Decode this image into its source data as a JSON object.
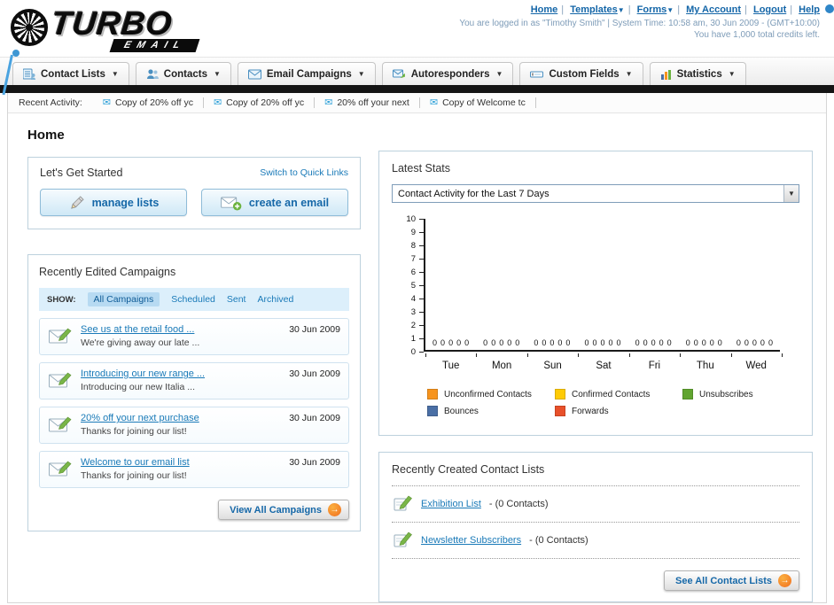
{
  "header": {
    "logo_title": "TURBO",
    "logo_subtitle": "EMAIL",
    "nav": [
      {
        "label": "Home"
      },
      {
        "label": "Templates"
      },
      {
        "label": "Forms"
      },
      {
        "label": "My Account"
      },
      {
        "label": "Logout"
      },
      {
        "label": "Help"
      }
    ],
    "login_info": "You are logged in as \"Timothy Smith\" | System Time: 10:58 am, 30 Jun 2009 - (GMT+10:00)",
    "credits_info": "You have 1,000 total credits left."
  },
  "tabs": [
    {
      "label": "Contact Lists"
    },
    {
      "label": "Contacts"
    },
    {
      "label": "Email Campaigns"
    },
    {
      "label": "Autoresponders"
    },
    {
      "label": "Custom Fields"
    },
    {
      "label": "Statistics"
    }
  ],
  "activity": {
    "label": "Recent Activity:",
    "items": [
      {
        "text": "Copy of 20% off yc"
      },
      {
        "text": "Copy of 20% off yc"
      },
      {
        "text": "20% off your next"
      },
      {
        "text": "Copy of Welcome tc"
      }
    ]
  },
  "page_title": "Home",
  "get_started": {
    "title": "Let's Get Started",
    "switch_link": "Switch to Quick Links",
    "manage_button": "manage lists",
    "create_button": "create an email"
  },
  "campaigns": {
    "title": "Recently Edited Campaigns",
    "show_label": "SHOW:",
    "filters": [
      "All Campaigns",
      "Scheduled",
      "Sent",
      "Archived"
    ],
    "items": [
      {
        "title": "See us at the retail food ...",
        "subtitle": "We're giving away our late ...",
        "date": "30 Jun 2009"
      },
      {
        "title": "Introducing our new range ...",
        "subtitle": "Introducing our new Italia ...",
        "date": "30 Jun 2009"
      },
      {
        "title": "20% off your next purchase",
        "subtitle": "Thanks for joining our list!",
        "date": "30 Jun 2009"
      },
      {
        "title": "Welcome to our email list",
        "subtitle": "Thanks for joining our list!",
        "date": "30 Jun 2009"
      }
    ],
    "view_all_label": "View All Campaigns"
  },
  "stats": {
    "title": "Latest Stats",
    "selected_option": "Contact Activity for the Last 7 Days",
    "chart_data": {
      "type": "bar",
      "title": "Contact Activity for the Last 7 Days",
      "categories": [
        "Tue",
        "Mon",
        "Sun",
        "Sat",
        "Fri",
        "Thu",
        "Wed"
      ],
      "series": [
        {
          "name": "Unconfirmed Contacts",
          "color": "#f7941d",
          "values": [
            0,
            0,
            0,
            0,
            0,
            0,
            0
          ]
        },
        {
          "name": "Confirmed Contacts",
          "color": "#ffcb05",
          "values": [
            0,
            0,
            0,
            0,
            0,
            0,
            0
          ]
        },
        {
          "name": "Unsubscribes",
          "color": "#61a530",
          "values": [
            0,
            0,
            0,
            0,
            0,
            0,
            0
          ]
        },
        {
          "name": "Bounces",
          "color": "#4a6fa5",
          "values": [
            0,
            0,
            0,
            0,
            0,
            0,
            0
          ]
        },
        {
          "name": "Forwards",
          "color": "#e8502a",
          "values": [
            0,
            0,
            0,
            0,
            0,
            0,
            0
          ]
        }
      ],
      "ylim": [
        0,
        10
      ],
      "ytick_step": 1,
      "grid": false,
      "legend_position": "bottom"
    }
  },
  "lists": {
    "title": "Recently Created Contact Lists",
    "items": [
      {
        "name": "Exhibition List",
        "suffix": "- (0 Contacts)"
      },
      {
        "name": "Newsletter Subscribers",
        "suffix": "- (0 Contacts)"
      }
    ],
    "see_all_label": "See All Contact Lists"
  }
}
